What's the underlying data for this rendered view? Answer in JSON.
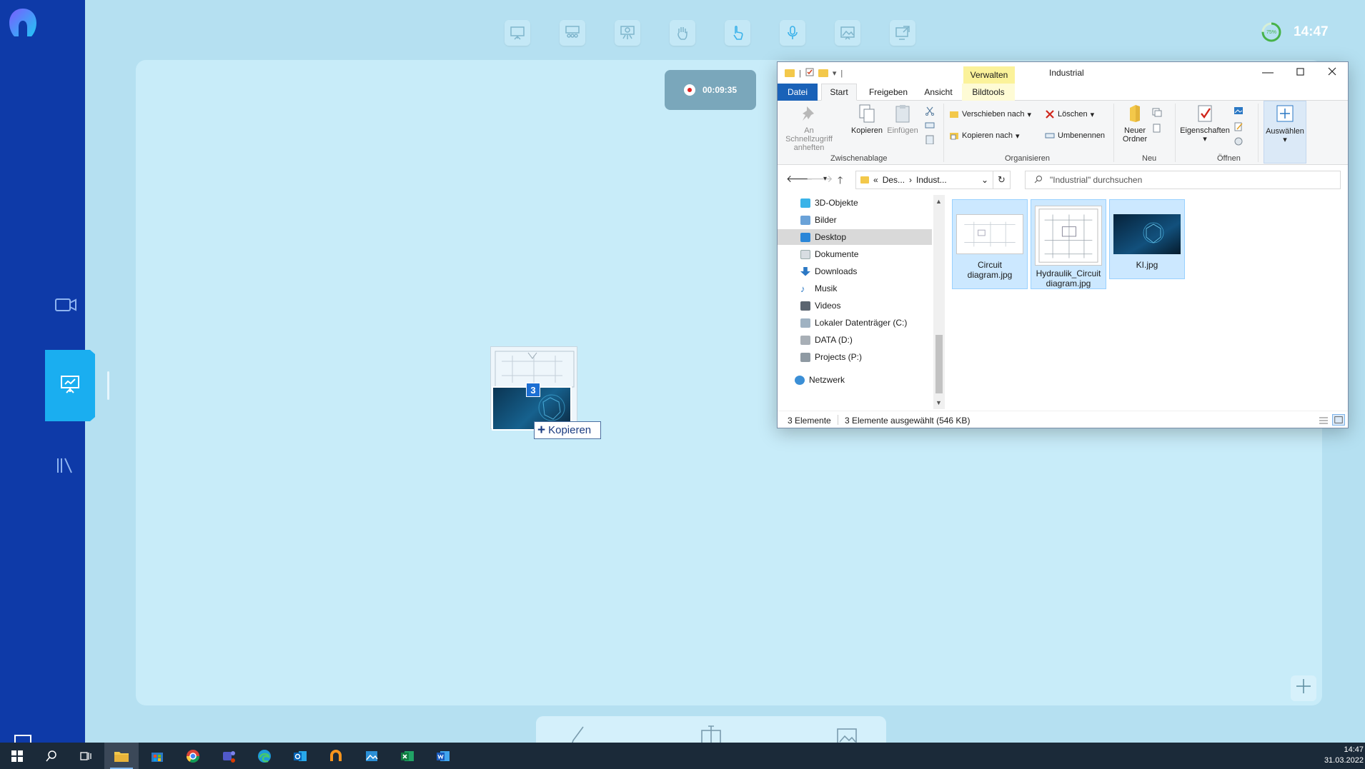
{
  "top_toolbar": {
    "tools": [
      "presentation-icon",
      "audience-icon",
      "breakout-icon",
      "hand-raise-icon",
      "pointer-icon",
      "microphone-icon",
      "whiteboard-image-icon",
      "screen-share-icon"
    ],
    "battery_percent": "75%",
    "clock": "14:47"
  },
  "sidebar": {
    "items": [
      "video-camera-icon",
      "presentation-icon",
      "library-icon"
    ],
    "active": "presentation-icon"
  },
  "canvas": {
    "recording_time": "00:09:35",
    "drag": {
      "count": "3",
      "drop_label": "Kopieren",
      "drop_symbol": "+"
    }
  },
  "explorer": {
    "context_tab": "Verwalten",
    "title": "Industrial",
    "tabs": [
      "Datei",
      "Start",
      "Freigeben",
      "Ansicht",
      "Bildtools"
    ],
    "ribbon": {
      "pin_label": "An Schnellzugriff anheften",
      "copy_label": "Kopieren",
      "paste_label": "Einfügen",
      "group_clipboard": "Zwischenablage",
      "move_to": "Verschieben nach",
      "copy_to": "Kopieren nach",
      "delete": "Löschen",
      "rename": "Umbenennen",
      "group_organize": "Organisieren",
      "new_folder": "Neuer Ordner",
      "group_new": "Neu",
      "properties": "Eigenschaften",
      "group_open": "Öffnen",
      "select": "Auswählen"
    },
    "address": {
      "prefix": "«",
      "part1": "Des...",
      "part2": "Indust..."
    },
    "search_placeholder": "\"Industrial\" durchsuchen",
    "nav_items": [
      {
        "label": "3D-Objekte"
      },
      {
        "label": "Bilder"
      },
      {
        "label": "Desktop"
      },
      {
        "label": "Dokumente"
      },
      {
        "label": "Downloads"
      },
      {
        "label": "Musik"
      },
      {
        "label": "Videos"
      },
      {
        "label": "Lokaler Datenträger (C:)"
      },
      {
        "label": "DATA (D:)"
      },
      {
        "label": "Projects (P:)"
      },
      {
        "label": "Netzwerk"
      }
    ],
    "selected_nav": "Desktop",
    "files": [
      {
        "name": "Circuit diagram.jpg"
      },
      {
        "name": "Hydraulik_Circuit diagram.jpg"
      },
      {
        "name": "KI.jpg"
      }
    ],
    "status_count": "3 Elemente",
    "status_selected": "3 Elemente ausgewählt (546 KB)"
  },
  "taskbar": {
    "apps": [
      "windows-start-icon",
      "search-icon",
      "task-view-icon",
      "file-explorer-icon",
      "store-icon",
      "chrome-icon",
      "teams-icon",
      "edge-icon",
      "outlook-icon",
      "app-ring-icon",
      "photos-icon",
      "excel-icon",
      "word-icon"
    ],
    "time": "14:47",
    "date": "31.03.2022"
  },
  "colors": {
    "sidebar": "#0e3aa8",
    "accent": "#1aaef0",
    "canvas": "#c8ecf9",
    "background": "#b5e0f1",
    "taskbar": "#1b2a39"
  }
}
